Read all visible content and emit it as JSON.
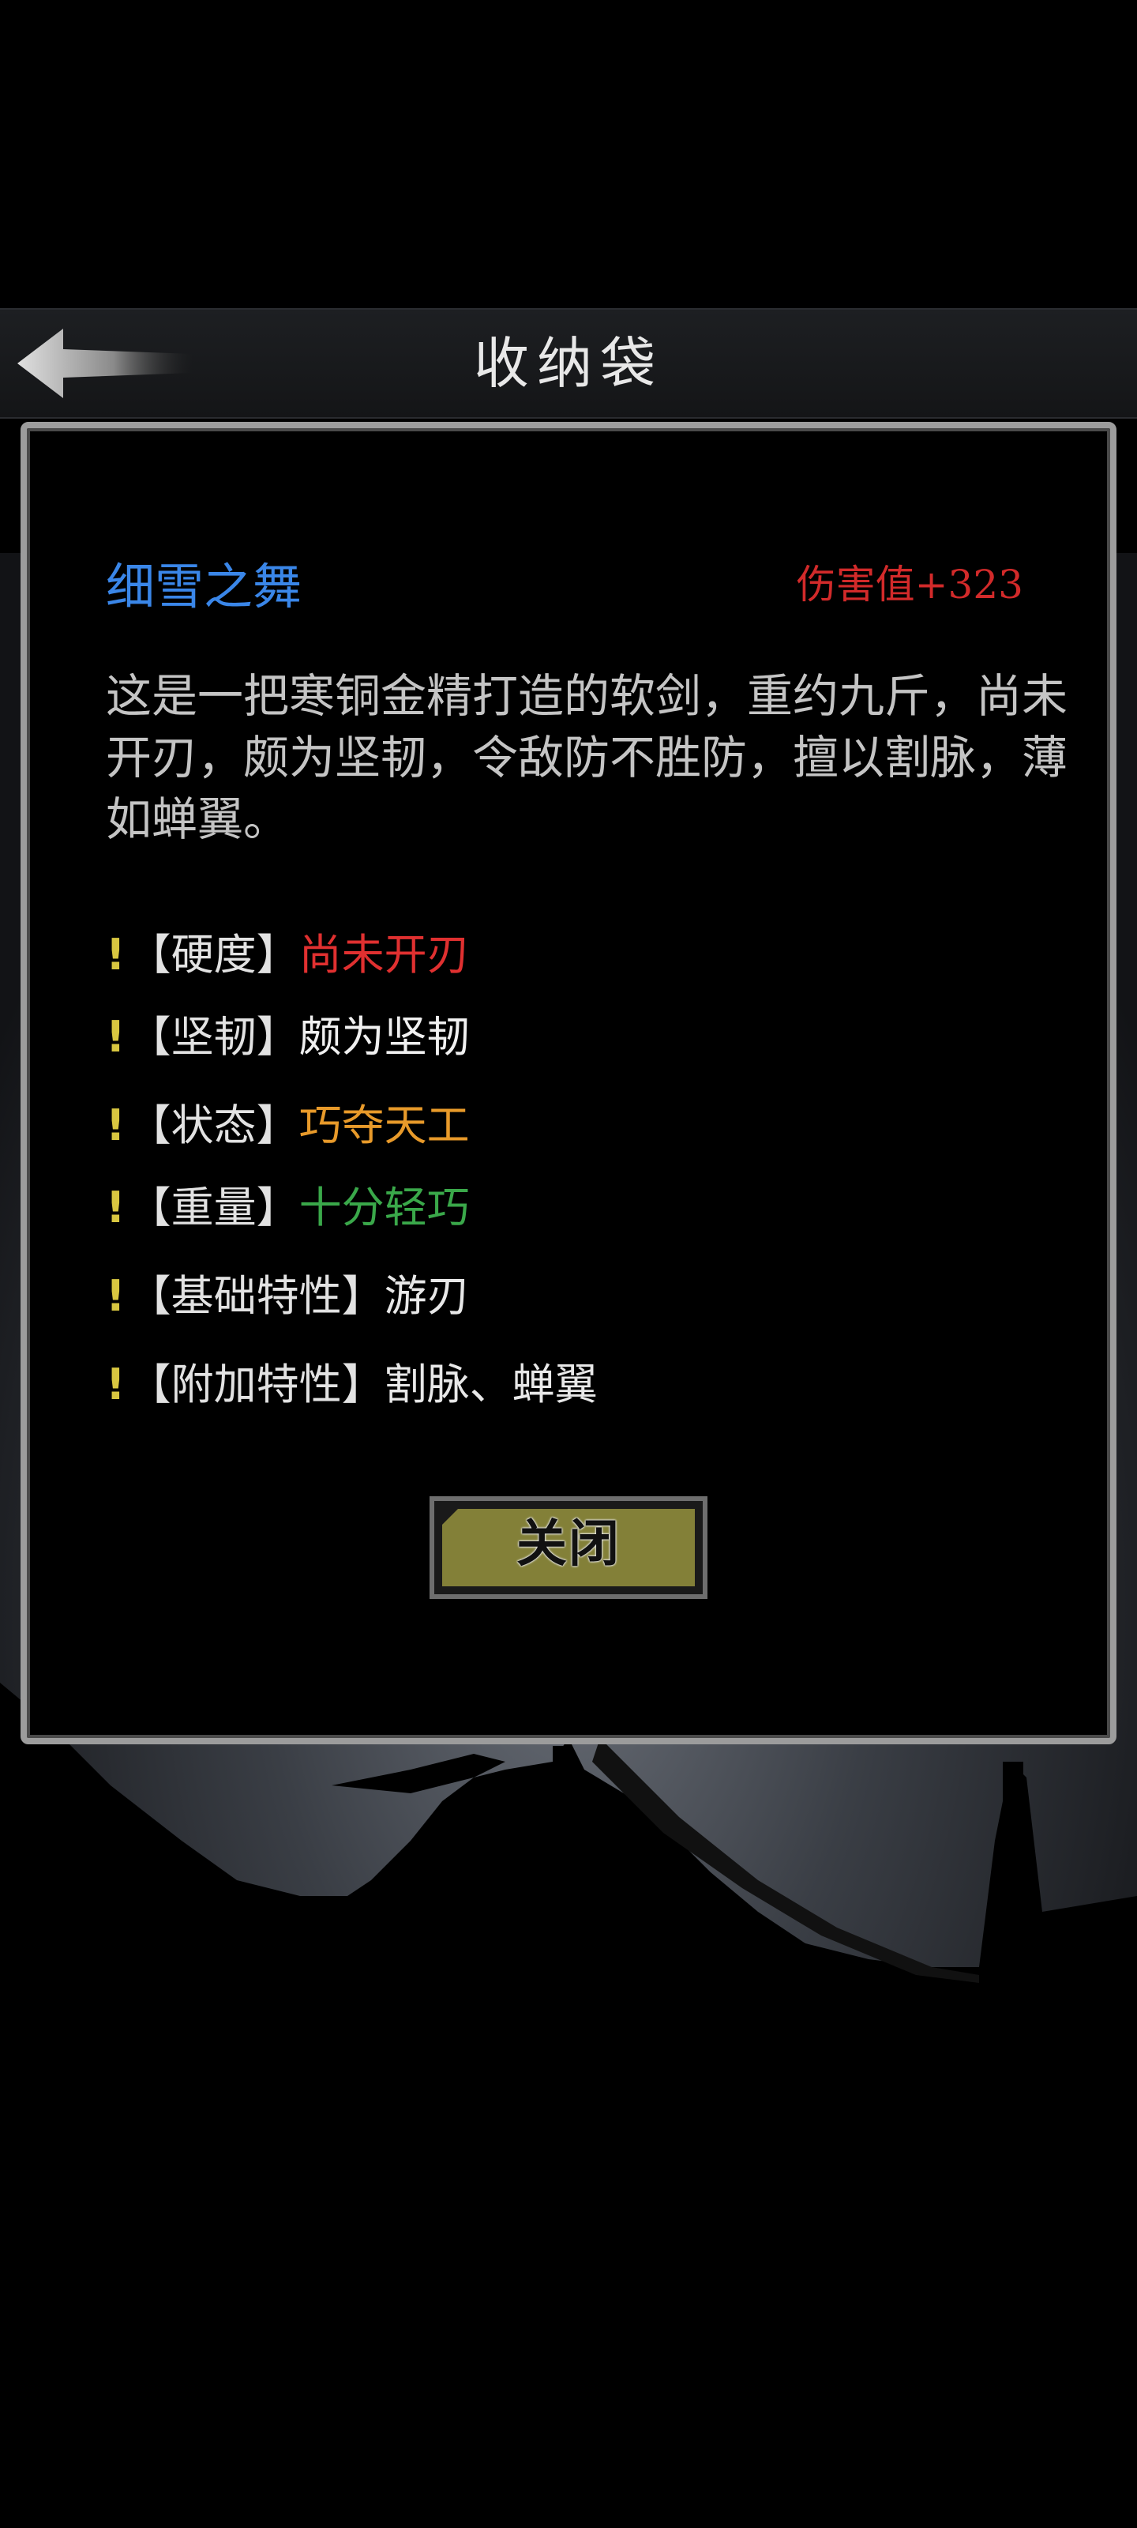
{
  "header": {
    "title": "收纳袋",
    "back_icon": "back-arrow-icon"
  },
  "item": {
    "name": "细雪之舞",
    "damage": "伤害值+323",
    "description": "这是一把寒铜金精打造的软剑，重约九斤，尚未开刃，颇为坚韧，令敌防不胜防，擅以割脉，薄如蝉翼。",
    "attributes": [
      {
        "mark": "!",
        "label": "【硬度】",
        "value": "尚未开刃",
        "color": "#e03030"
      },
      {
        "mark": "!",
        "label": "【坚韧】",
        "value": "颇为坚韧",
        "color": "#f0f0f0"
      },
      {
        "mark": "!",
        "label": "【状态】",
        "value": "巧夺天工",
        "color": "#e89a2a"
      },
      {
        "mark": "!",
        "label": "【重量】",
        "value": "十分轻巧",
        "color": "#3aa84a"
      },
      {
        "mark": "!",
        "label": "【基础特性】",
        "value": "游刃",
        "color": "#e8e8e8"
      },
      {
        "mark": "!",
        "label": "【附加特性】",
        "value": "割脉、蝉翼",
        "color": "#e8e8e8"
      }
    ]
  },
  "close_button": {
    "label": "关闭"
  },
  "colors": {
    "item_name": "#3a86e8",
    "damage": "#d22a2a",
    "mark": "#d8c640",
    "button_fill": "#838038"
  }
}
